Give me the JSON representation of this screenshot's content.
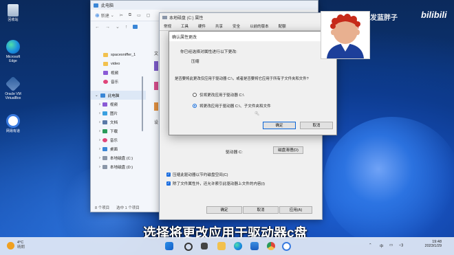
{
  "desktop_icons": [
    {
      "label": "回收站"
    },
    {
      "label": "Microsoft Edge"
    },
    {
      "label": "Oracle VM VirtualBox"
    },
    {
      "label": "网易有道"
    }
  ],
  "explorer": {
    "title": "此电脑",
    "toolbar_new": "新建",
    "view_label": "V",
    "nav_items": [
      {
        "label": "spacesniffer_1"
      },
      {
        "label": "video"
      },
      {
        "label": "视频"
      },
      {
        "label": "音乐"
      },
      {
        "label": "此电脑"
      },
      {
        "label": "视频"
      },
      {
        "label": "图片"
      },
      {
        "label": "文档"
      },
      {
        "label": "下载"
      },
      {
        "label": "音乐"
      },
      {
        "label": "桌面"
      },
      {
        "label": "本地磁盘 (C:)"
      },
      {
        "label": "本地磁盘 (D:)"
      }
    ],
    "side_letters": [
      "文",
      "设"
    ],
    "status_items": "8 个项目",
    "status_selected": "选中 1 个项目"
  },
  "properties": {
    "title": "本地磁盘 (C:) 属性",
    "tabs": [
      "常规",
      "工具",
      "硬件",
      "共享",
      "安全",
      "以前的版本",
      "配额"
    ],
    "drive_label": "驱动器 C:",
    "cleanup_button": "磁盘清理(D)",
    "compress_checkbox": "压缩此驱动器以节约磁盘空间(C)",
    "index_checkbox": "除了文件属性外，还允许索引此驱动器上文件的内容(I)",
    "ok": "确定",
    "cancel": "取消",
    "apply": "应用(A)"
  },
  "confirm_dialog": {
    "title": "确认属性更改",
    "line1": "你已经选择对属性进行以下更改:",
    "change": "压缩",
    "question": "是否要将此更改仅应用于驱动器 C:\\，或者是否要将它应用于所有子文件夹和文件?",
    "option_drive_only": "仅将更改应用于驱动器 C:\\",
    "option_all": "将更改应用于驱动器 C:\\、子文件夹和文件",
    "ok": "确定",
    "cancel": "取消"
  },
  "overlay": {
    "watermark": "头发蓝胖子",
    "bilibili": "bilibili",
    "subtitle": "选择将更改应用于驱动器c盘"
  },
  "taskbar": {
    "weather_temp": "4°C",
    "weather_desc": "晴朗",
    "ime": "中",
    "time": "19:48",
    "date": "2023/1/29"
  },
  "colors": {
    "accent": "#0a64d6",
    "checkbox_blue": "#1a6de0"
  }
}
